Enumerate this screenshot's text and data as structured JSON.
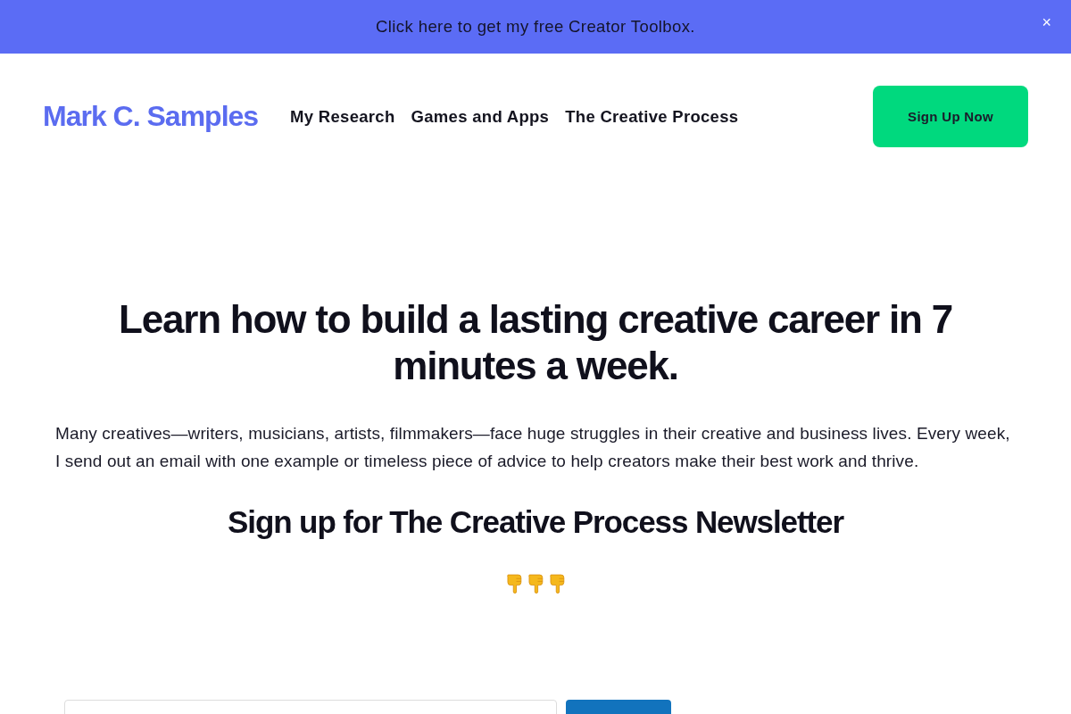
{
  "announcement_bar": {
    "text": "Click here to get my free Creator Toolbox.",
    "close": "×"
  },
  "header": {
    "logo": "Mark C. Samples",
    "nav": [
      {
        "label": "My Research"
      },
      {
        "label": "Games and Apps"
      },
      {
        "label": "The Creative Process"
      }
    ],
    "cta": "Sign Up Now"
  },
  "hero": {
    "headline": "Learn how to build a lasting creative career in 7 minutes a week.",
    "intro": "Many creatives—writers, musicians, artists, filmmakers—face huge struggles in their creative and business lives. Every week, I send out an email with one example or timeless piece of advice to help creators make their best work and thrive.",
    "signup_heading": "Sign up for The Creative Process Newsletter"
  }
}
